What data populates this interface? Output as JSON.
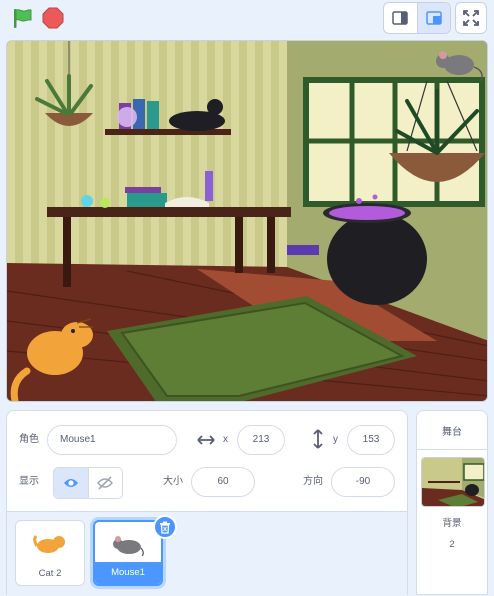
{
  "toolbar": {
    "green_flag_icon": "green-flag-icon",
    "stop_icon": "stop-icon",
    "small_stage_icon": "small-stage-icon",
    "large_stage_icon": "large-stage-icon",
    "fullscreen_icon": "fullscreen-icon"
  },
  "sprite_info": {
    "sprite_label": "角色",
    "sprite_name": "Mouse1",
    "x_label": "x",
    "x_value": "213",
    "y_label": "y",
    "y_value": "153",
    "show_label": "显示",
    "size_label": "大小",
    "size_value": "60",
    "direction_label": "方向",
    "direction_value": "-90"
  },
  "sprites": [
    {
      "name": "Cat 2",
      "selected": false
    },
    {
      "name": "Mouse1",
      "selected": true
    }
  ],
  "stage_panel": {
    "title": "舞台",
    "backdrops_label": "背景",
    "backdrops_count": "2"
  },
  "colors": {
    "accent": "#4c97ff",
    "flag": "#4cbf56",
    "stop": "#ec5959"
  }
}
